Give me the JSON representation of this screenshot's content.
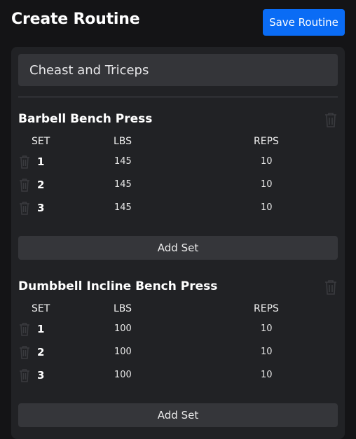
{
  "header": {
    "title": "Create Routine",
    "save_label": "Save Routine"
  },
  "routine": {
    "name_value": "Cheast and Triceps"
  },
  "columns": {
    "set": "SET",
    "lbs": "LBS",
    "reps": "REPS"
  },
  "icons": {
    "delete": "trash-icon"
  },
  "colors": {
    "accent": "#0a6cf5",
    "panel": "#212225",
    "background": "#141416",
    "input": "#343539",
    "icon_muted": "#3a3b3f"
  },
  "exercises": [
    {
      "name": "Barbell Bench Press",
      "add_set_label": "Add Set",
      "sets": [
        {
          "set": "1",
          "lbs": "145",
          "reps": "10"
        },
        {
          "set": "2",
          "lbs": "145",
          "reps": "10"
        },
        {
          "set": "3",
          "lbs": "145",
          "reps": "10"
        }
      ]
    },
    {
      "name": "Dumbbell Incline Bench Press",
      "add_set_label": "Add Set",
      "sets": [
        {
          "set": "1",
          "lbs": "100",
          "reps": "10"
        },
        {
          "set": "2",
          "lbs": "100",
          "reps": "10"
        },
        {
          "set": "3",
          "lbs": "100",
          "reps": "10"
        }
      ]
    }
  ]
}
